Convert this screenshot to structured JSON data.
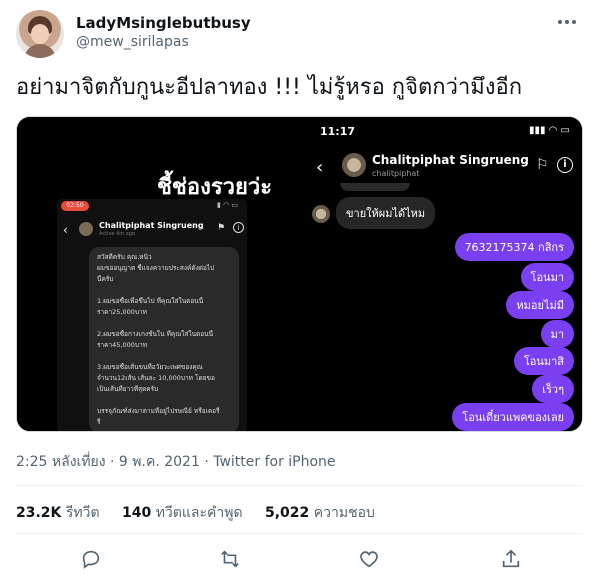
{
  "user": {
    "display_name": "LadyMsinglebutbusy",
    "handle": "@mew_sirilapas"
  },
  "tweet": {
    "text": "อย่ามาจิตกับกูนะอีปลาทอง !!! ไม่รู้หรอ กูจิตกว่ามึงอีก",
    "timestamp": "2:25 หลังเที่ยง · 9 พ.ค. 2021 · Twitter for iPhone"
  },
  "left_image": {
    "caption": "ชี้ช่องรวยว่ะ",
    "rec_time": "02:50",
    "contact_name": "Chalitpiphat Singrueng",
    "contact_status": "Active 4m ago",
    "message_lines": [
      "สวัสดีครับ คุณ.หนิว",
      "ผมขออนุญาต ชี้แจงความประสงค์ดังต่อไป",
      "นี้ครับ",
      "",
      "1.ผมขอซื้อเพื่อขึ้นไป ที่คุณใส่ในตอนนี้",
      "ราคา25,000บาท",
      "",
      "2.ผมขอซื้อกางเกงชั้นใน ที่คุณใส่ในตอนนี้",
      "ราคา45,000บาท",
      "",
      "3.ผมขอซื้อเส้นขนที่อวัยวะเพศของคุณ",
      "จำนวน12เส้น เส้นละ 10,000บาท โดยขอ",
      "เป็นเส้นที่ยาวที่สุดครับ",
      "",
      "บรรจุภัณฑ์ส่งมาตามที่อยู่ไปรษณีย์ หรือเคอรี่",
      "รี่"
    ]
  },
  "right_image": {
    "status_time": "11:17",
    "status_icons": "▮▮▮ ◠ ▭",
    "contact_name": "Chalitpiphat Singrueng",
    "contact_handle": "chalitpiphat",
    "received_message": "ขายให้ผมได้ไหม",
    "sent_messages": [
      "7632175374 กสิกร",
      "โอนมา",
      "หมอยไม่มี",
      "มา",
      "โอนมาสิ",
      "เร็วๆ",
      "โอนเดี๋ยวแพคของเลย"
    ]
  },
  "stats": {
    "retweets_count": "23.2K",
    "retweets_label": "รีทวีต",
    "quotes_count": "140",
    "quotes_label": "ทวีตและคำพูด",
    "likes_count": "5,022",
    "likes_label": "ความชอบ"
  },
  "icons": {
    "more": "more-icon",
    "reply": "reply-icon",
    "retweet": "retweet-icon",
    "like": "heart-icon",
    "share": "share-icon"
  },
  "colors": {
    "sent_bubble": "#7a3ff0",
    "secondary_text": "#536471"
  }
}
